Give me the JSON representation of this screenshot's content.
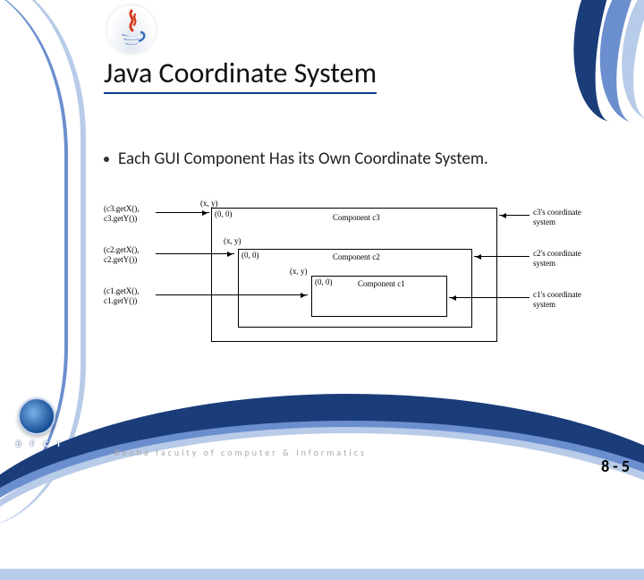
{
  "title": "Java Coordinate System",
  "bullet": "Each GUI Component Has its Own Coordinate System.",
  "diagram": {
    "c3": {
      "origin_label": "(0, 0)",
      "name": "Component c3"
    },
    "c2": {
      "origin_label": "(0, 0)",
      "name": "Component c2"
    },
    "c1": {
      "origin_label": "(0, 0)",
      "name": "Component c1"
    },
    "xy_c3": "(x, y)",
    "xy_c2": "(x, y)",
    "loc_c3": "(c3.getX(),\nc3.getY())",
    "loc_c2": "(c2.getX(),\nc2.getY())",
    "loc_c1": "(c1.getX(),\nc1.getY())",
    "note_c3": "c3's coordinate\nsystem",
    "note_c2": "c2's coordinate\nsystem",
    "note_c1": "c1's coordinate\nsystem"
  },
  "logo": {
    "bfci_letters": "B F C I"
  },
  "footer": "Benha  faculty  of  computer  &  Informatics",
  "page_number": "8 - 5"
}
